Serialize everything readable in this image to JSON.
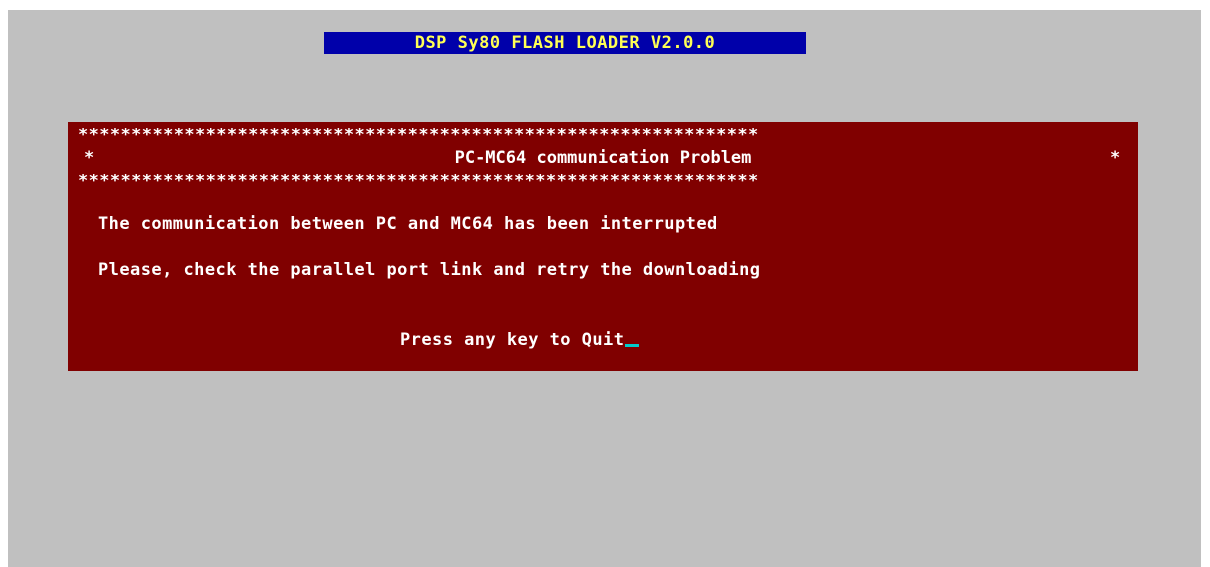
{
  "app": {
    "title": "DSP Sy80 FLASH LOADER V2.0.0"
  },
  "dialog": {
    "stars_line": "****************************************************************",
    "side_star": "*",
    "title": "PC-MC64 communication Problem",
    "message_line1": "The communication between PC and MC64 has been interrupted",
    "message_line2": "Please, check the parallel port link and retry the downloading",
    "prompt": "Press any key to Quit"
  },
  "colors": {
    "screen_background": "#c0c0c0",
    "title_background": "#0000aa",
    "title_text": "#ffff55",
    "dialog_background": "#800000",
    "dialog_text": "#ffffff",
    "cursor": "#00cccc"
  },
  "cursor": {
    "icon": "text-cursor-underscore"
  }
}
